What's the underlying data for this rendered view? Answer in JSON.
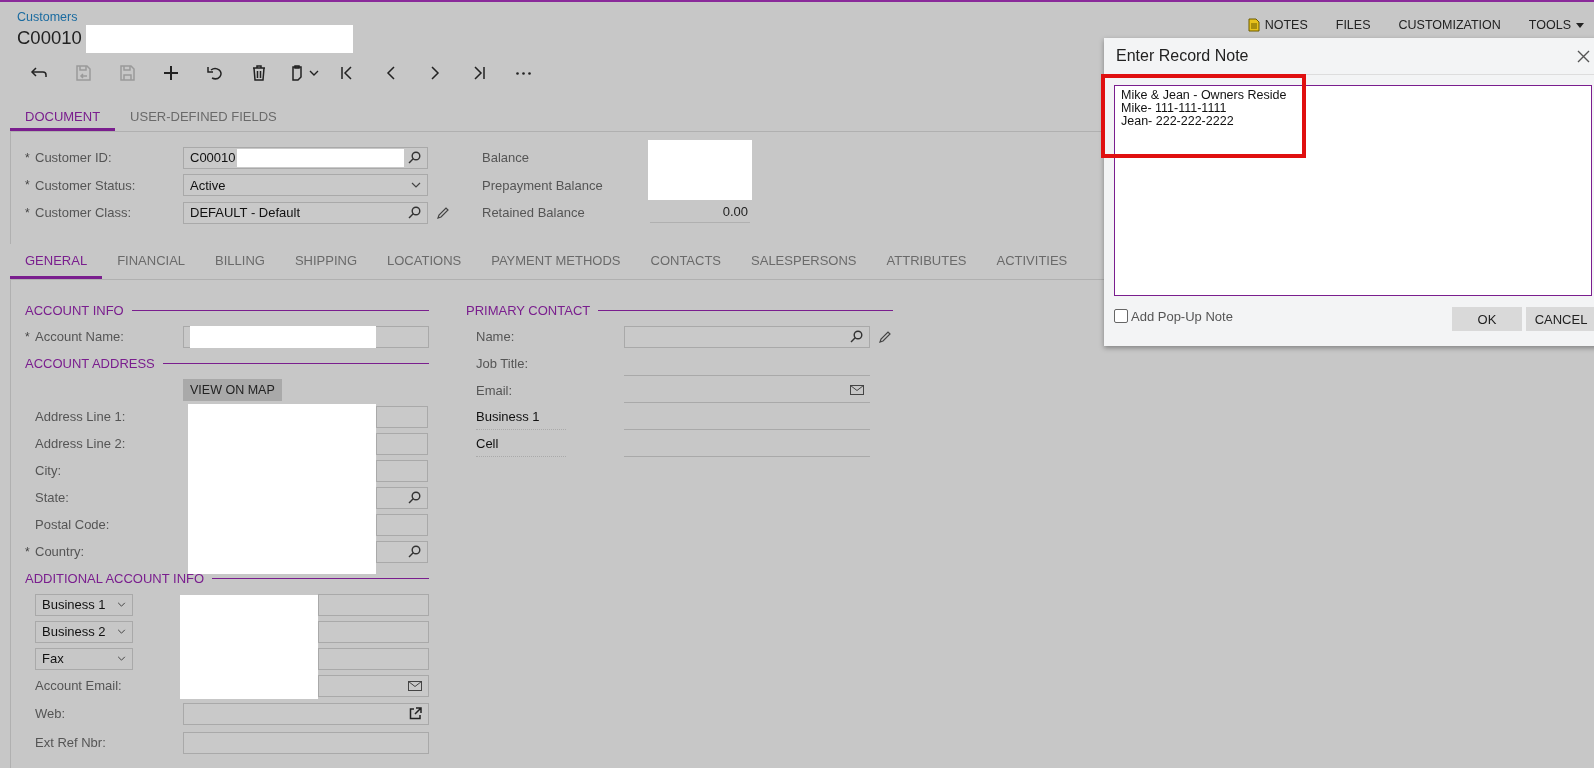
{
  "header": {
    "breadcrumb": "Customers",
    "title": "C00010"
  },
  "top_links": [
    {
      "label": "NOTES",
      "kind": "notes"
    },
    {
      "label": "FILES",
      "kind": "plain"
    },
    {
      "label": "CUSTOMIZATION",
      "kind": "plain"
    },
    {
      "label": "TOOLS",
      "kind": "menu"
    }
  ],
  "toolbar": [
    {
      "kind": "back",
      "disabled": false
    },
    {
      "kind": "save-close",
      "disabled": true
    },
    {
      "kind": "save",
      "disabled": true
    },
    {
      "kind": "add",
      "disabled": false
    },
    {
      "kind": "undo",
      "disabled": false
    },
    {
      "kind": "delete",
      "disabled": false
    },
    {
      "kind": "copy",
      "disabled": false
    },
    {
      "kind": "first",
      "disabled": false
    },
    {
      "kind": "prev",
      "disabled": false
    },
    {
      "kind": "next",
      "disabled": false
    },
    {
      "kind": "last",
      "disabled": false
    },
    {
      "kind": "more",
      "disabled": false
    }
  ],
  "doc_tabs": [
    {
      "label": "DOCUMENT",
      "selected": true
    },
    {
      "label": "USER-DEFINED FIELDS",
      "selected": false
    }
  ],
  "summary": {
    "fields": [
      {
        "label": "Customer ID:",
        "required_mark": "*",
        "kind": "lookup",
        "value": "C00010"
      },
      {
        "label": "Customer Status:",
        "required_mark": "*",
        "kind": "select",
        "value": "Active"
      },
      {
        "label": "Customer Class:",
        "required_mark": "*",
        "kind": "lookup",
        "value": "DEFAULT - Default",
        "editable": true
      }
    ],
    "balances": [
      {
        "label": "Balance"
      },
      {
        "label": "Prepayment Balance"
      },
      {
        "label": "Retained Balance",
        "value": "0.00"
      }
    ]
  },
  "tabs": [
    {
      "label": "GENERAL",
      "selected": true
    },
    {
      "label": "FINANCIAL",
      "selected": false
    },
    {
      "label": "BILLING",
      "selected": false
    },
    {
      "label": "SHIPPING",
      "selected": false
    },
    {
      "label": "LOCATIONS",
      "selected": false
    },
    {
      "label": "PAYMENT METHODS",
      "selected": false
    },
    {
      "label": "CONTACTS",
      "selected": false
    },
    {
      "label": "SALESPERSONS",
      "selected": false
    },
    {
      "label": "ATTRIBUTES",
      "selected": false
    },
    {
      "label": "ACTIVITIES",
      "selected": false
    }
  ],
  "account_info": {
    "title": "ACCOUNT INFO",
    "fields": [
      {
        "label": "Account Name:",
        "required_mark": "*"
      }
    ]
  },
  "account_address": {
    "title": "ACCOUNT ADDRESS",
    "button": "VIEW ON MAP",
    "fields": [
      {
        "label": "Address Line 1:",
        "kind": "text"
      },
      {
        "label": "Address Line 2:",
        "kind": "text"
      },
      {
        "label": "City:",
        "kind": "text"
      },
      {
        "label": "State:",
        "kind": "lookup"
      },
      {
        "label": "Postal Code:",
        "kind": "text"
      },
      {
        "label": "Country:",
        "required_mark": "*",
        "kind": "lookup"
      }
    ]
  },
  "additional_info": {
    "title": "ADDITIONAL ACCOUNT INFO",
    "fields": [
      {
        "kind": "phone-select",
        "value": "Business 1"
      },
      {
        "kind": "phone-select",
        "value": "Business 2"
      },
      {
        "kind": "phone-select",
        "value": "Fax"
      },
      {
        "kind": "email",
        "label": "Account Email:"
      },
      {
        "kind": "link",
        "label": "Web:"
      },
      {
        "kind": "text",
        "label": "Ext Ref Nbr:"
      }
    ]
  },
  "primary_contact": {
    "title": "PRIMARY CONTACT",
    "fields": [
      {
        "label": "Name:",
        "kind": "lookup"
      },
      {
        "label": "Job Title:",
        "kind": "plain"
      },
      {
        "label": "Email:",
        "kind": "plain-email"
      },
      {
        "label": "Business 1",
        "kind": "phone"
      },
      {
        "label": "Cell",
        "kind": "phone"
      }
    ]
  },
  "dialog": {
    "title": "Enter Record Note",
    "note": "Mike & Jean - Owners Reside\nMike- 111-111-1111\nJean- 222-222-2222",
    "popup_checkbox": {
      "label": "Add Pop-Up Note",
      "checked": false
    },
    "buttons": [
      "OK",
      "CANCEL"
    ]
  }
}
